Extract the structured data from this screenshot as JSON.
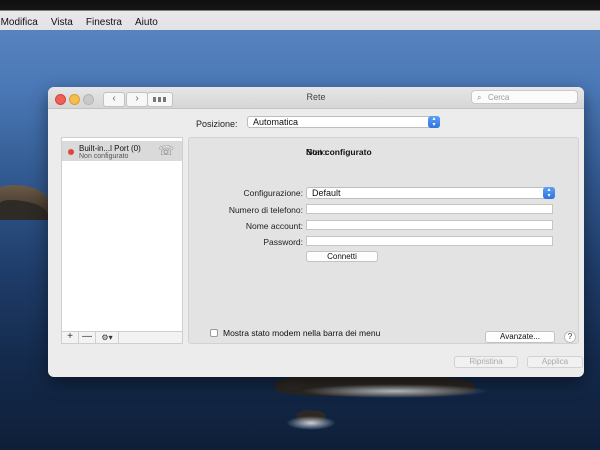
{
  "menubar": {
    "items": [
      "Modifica",
      "Vista",
      "Finestra",
      "Aiuto"
    ]
  },
  "window": {
    "title": "Rete",
    "search_placeholder": "Cerca",
    "location_label": "Posizione:",
    "location_value": "Automatica"
  },
  "sidebar": {
    "services": [
      {
        "name": "Built-in...l Port (0)",
        "status": "Non configurato",
        "status_color": "#e0453a"
      }
    ],
    "add_label": "+",
    "remove_label": "—"
  },
  "detail": {
    "status_label": "Stato:",
    "status_value": "Non configurato",
    "config_label": "Configurazione:",
    "config_value": "Default",
    "phone_label": "Numero di telefono:",
    "phone_value": "",
    "account_label": "Nome account:",
    "account_value": "",
    "password_label": "Password:",
    "password_value": "",
    "connect_label": "Connetti",
    "modem_checkbox_label": "Mostra stato modem nella barra dei menu",
    "modem_checkbox_checked": false,
    "advanced_label": "Avanzate...",
    "help_label": "?"
  },
  "footer": {
    "revert_label": "Ripristina",
    "apply_label": "Applica"
  },
  "colors": {
    "accent": "#2f73e0",
    "close": "#ee5f58",
    "minimize": "#f4bd50"
  }
}
